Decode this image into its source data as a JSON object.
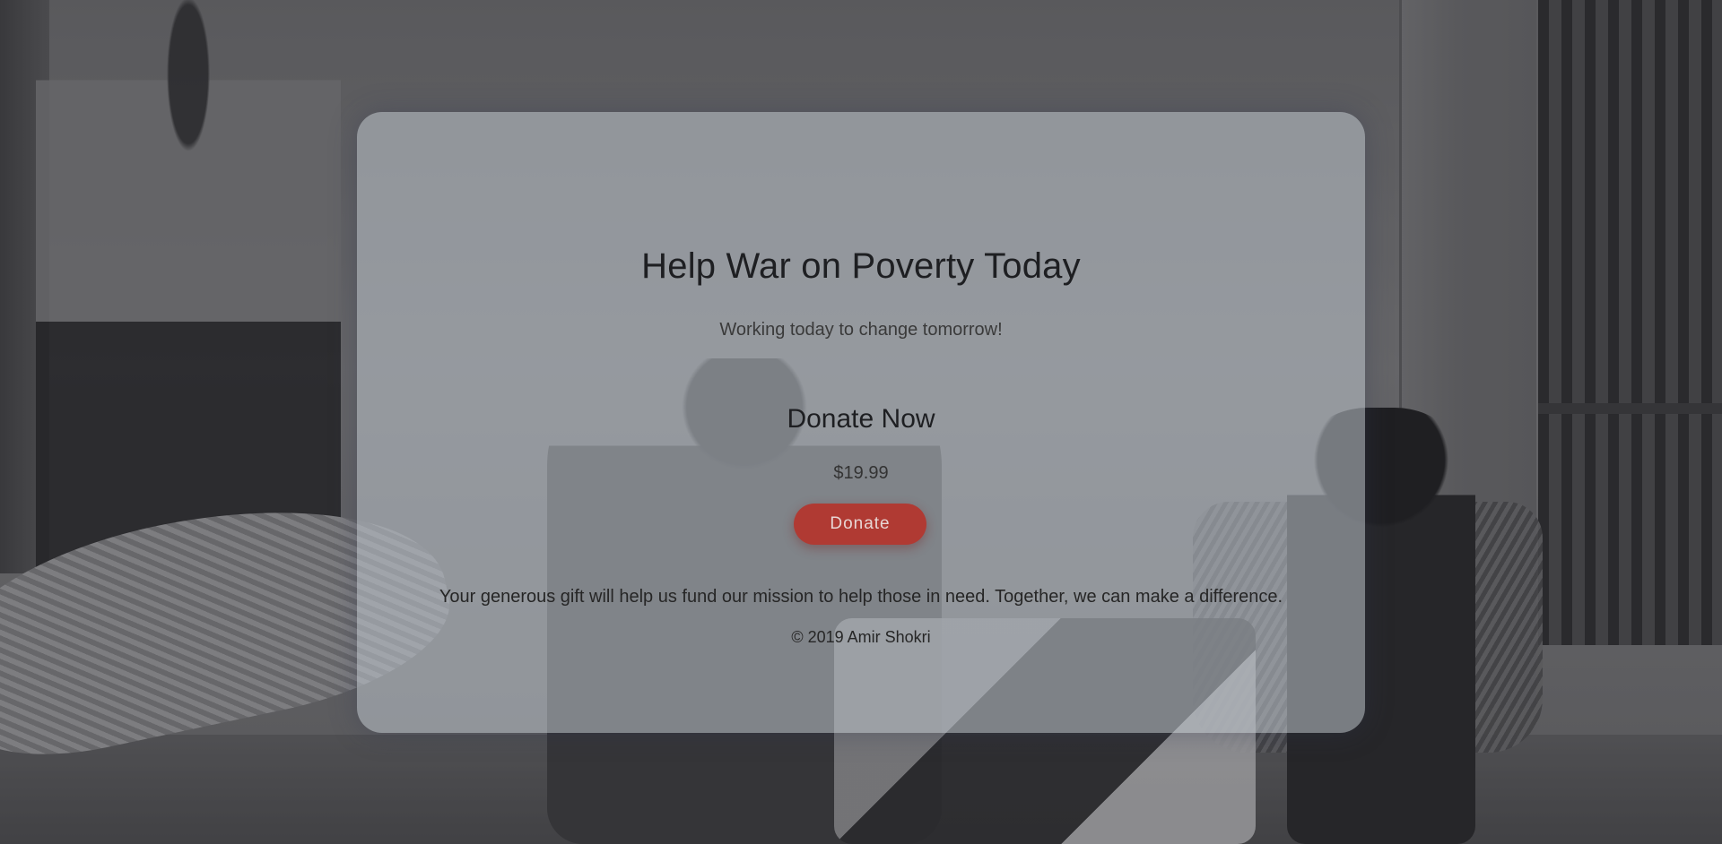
{
  "hero": {
    "title": "Help War on Poverty Today",
    "subtitle": "Working today to change tomorrow!"
  },
  "donation": {
    "heading": "Donate Now",
    "price": "$19.99",
    "button_label": "Donate"
  },
  "footer": {
    "mission": "Your generous gift will help us fund our mission to help those in need. Together, we can make a difference.",
    "copyright": "© 2019 Amir Shokri"
  },
  "colors": {
    "button_background": "#b03a33",
    "card_background": "rgba(190,196,204,0.55)"
  }
}
